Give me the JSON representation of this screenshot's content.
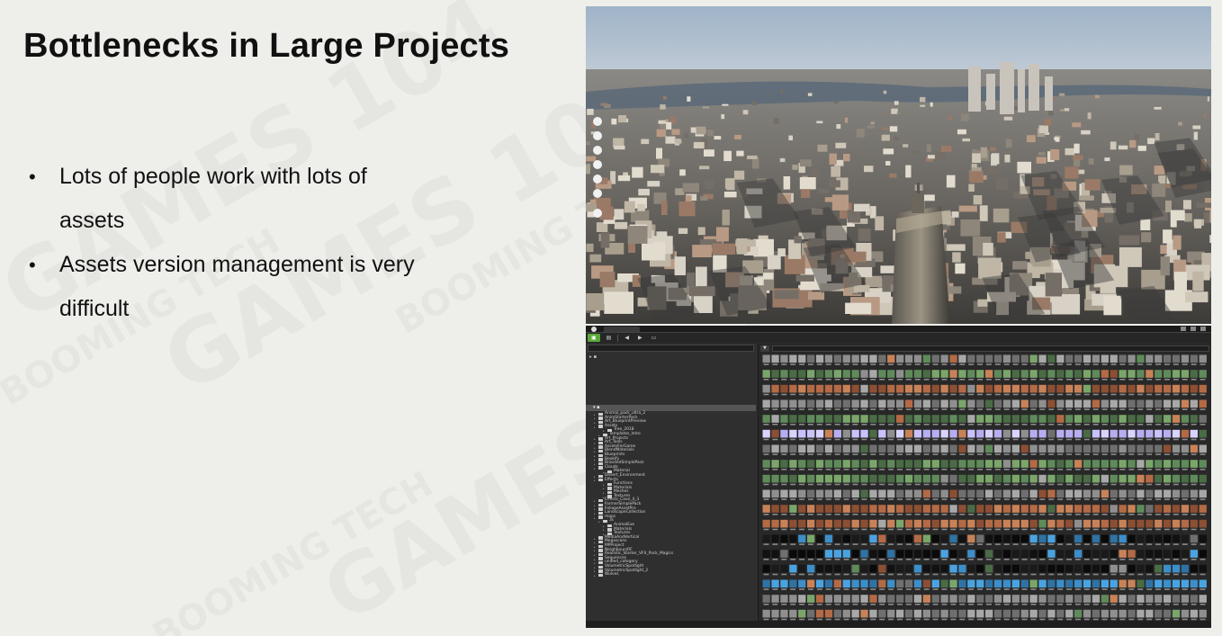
{
  "slide": {
    "title": "Bottlenecks in Large Projects",
    "bullets": [
      "Lots of people work with lots of assets",
      "Assets version management is very difficult"
    ]
  },
  "watermarks": [
    "GAMES 104",
    "BOOMING TECH"
  ],
  "editor": {
    "folders": [
      "Animal_pack_ultra_2",
      "AnimStarterPack",
      "Art_BlueprintPreview",
      "Assets",
      "Tree_2018",
      "Templates_Intro",
      "Art_Projects",
      "Art_Tools",
      "AssetsForGame",
      "BlendMaterials",
      "Blueprints",
      "Bookify",
      "BrandedSimplePack",
      "Clouds",
      "Material",
      "Desert_Environment",
      "Effects",
      "Functions",
      "Materials",
      "Meshes",
      "Textures",
      "Effects_Cave_4_3",
      "FarmerSimplePack",
      "FoliageAssetPro",
      "LandscapeCollection",
      "maps",
      "3s",
      "AnimalExe",
      "Materials",
      "Textures",
      "MediaAndVertical",
      "Megascans",
      "MPProject",
      "NeighboursRF",
      "Realistic_Starter_VFX_Pack_Magics",
      "Sequences",
      "unified_category",
      "VolumetricSpotlight",
      "VolumetricSpotlight_2",
      "Wolves"
    ]
  }
}
